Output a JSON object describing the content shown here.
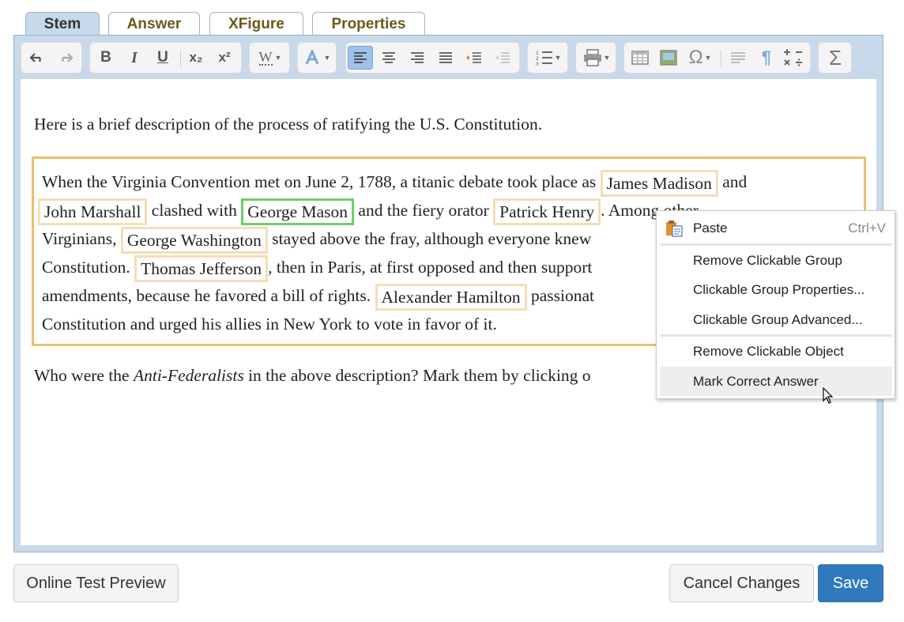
{
  "tabs": [
    {
      "label": "Stem",
      "active": true
    },
    {
      "label": "Answer",
      "active": false
    },
    {
      "label": "XFigure",
      "active": false
    },
    {
      "label": "Properties",
      "active": false
    }
  ],
  "toolbar": {
    "bold": "B",
    "italic": "I",
    "underline": "U",
    "subscript": "x₂",
    "superscript": "x²",
    "word_style": "W",
    "omega": "Ω",
    "sigma": "Σ",
    "pilcrow": "¶",
    "active_button": "align-left"
  },
  "editor": {
    "intro": "Here is a brief description of the process of ratifying the U.S. Constitution.",
    "passage": {
      "line1_a": "When the Virginia Convention met on June 2, 1788, a titanic debate took place as",
      "chip_madison": "James Madison",
      "line1_b": "and",
      "chip_marshall": "John Marshall",
      "line2_a": "clashed with",
      "chip_mason": "George Mason",
      "line2_b": "and the fiery orator",
      "chip_henry": "Patrick Henry",
      "line2_c": ". Among other",
      "line3_a": "Virginians,",
      "chip_washington": "George Washington",
      "line3_b": "stayed above the fray, although everyone knew",
      "line4_a": "Constitution.",
      "chip_jefferson": "Thomas Jefferson",
      "line4_b": ", then in Paris, at first opposed and then support",
      "line5_a": "amendments, because he favored a bill of rights.",
      "chip_hamilton": "Alexander Hamilton",
      "line5_b": "passionat",
      "line6": "Constitution and urged his allies in New York to vote in favor of it."
    },
    "question_a": "Who were the ",
    "question_em": "Anti-Federalists",
    "question_b": " in the above description? Mark them by clicking o"
  },
  "context_menu": {
    "paste": "Paste",
    "paste_shortcut": "Ctrl+V",
    "remove_group": "Remove Clickable Group",
    "group_properties": "Clickable Group Properties...",
    "group_advanced": "Clickable Group Advanced...",
    "remove_object": "Remove Clickable Object",
    "mark_correct": "Mark Correct Answer"
  },
  "footer": {
    "preview": "Online Test Preview",
    "cancel": "Cancel Changes",
    "save": "Save"
  },
  "colors": {
    "chip_border": "#f6ddb7",
    "chip_correct_border": "#6ccf6c",
    "passage_border": "#ebbf6e",
    "save_button": "#2f7abd",
    "editor_frame": "#c7d9ea"
  }
}
